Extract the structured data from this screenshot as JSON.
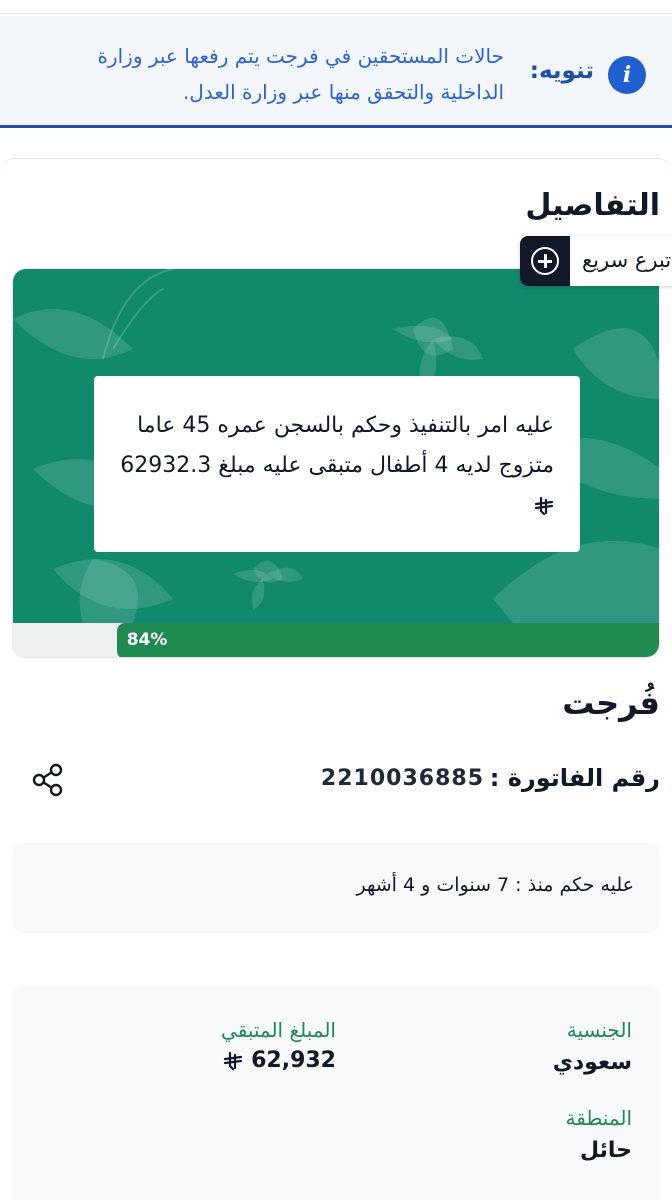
{
  "notice": {
    "icon": "info-icon",
    "label": "تنويه:",
    "text": "حالات المستحقين في فرجت يتم رفعها عبر وزارة الداخلية والتحقق منها عبر وزارة العدل."
  },
  "details": {
    "title": "التفاصيل"
  },
  "quick_donate": {
    "label": "تبرع سريع",
    "icon": "plus-circle-icon"
  },
  "hero": {
    "description": "عليه امر بالتنفيذ وحكم بالسجن عمره 45 عاما متزوج لديه 4 أطفال متبقى عليه مبلغ 62932.3",
    "currency_icon": "riyal-icon",
    "progress_fraction": 0.84,
    "progress_label": "84%",
    "colors": {
      "background": "#11896b",
      "progress": "#208a53"
    }
  },
  "org": {
    "name": "فُرجت"
  },
  "invoice": {
    "label": "رقم الفاتورة :",
    "number": "2210036885",
    "share_icon": "share-icon"
  },
  "sentence": {
    "text": "عليه حكم منذ : 7 سنوات و 4 أشهر"
  },
  "info": {
    "nationality_label": "الجنسية",
    "nationality_value": "سعودي",
    "region_label": "المنطقة",
    "region_value": "حائل",
    "remaining_label": "المبلغ المتبقي",
    "remaining_value": "62,932",
    "accent_color": "#1f8a55"
  }
}
